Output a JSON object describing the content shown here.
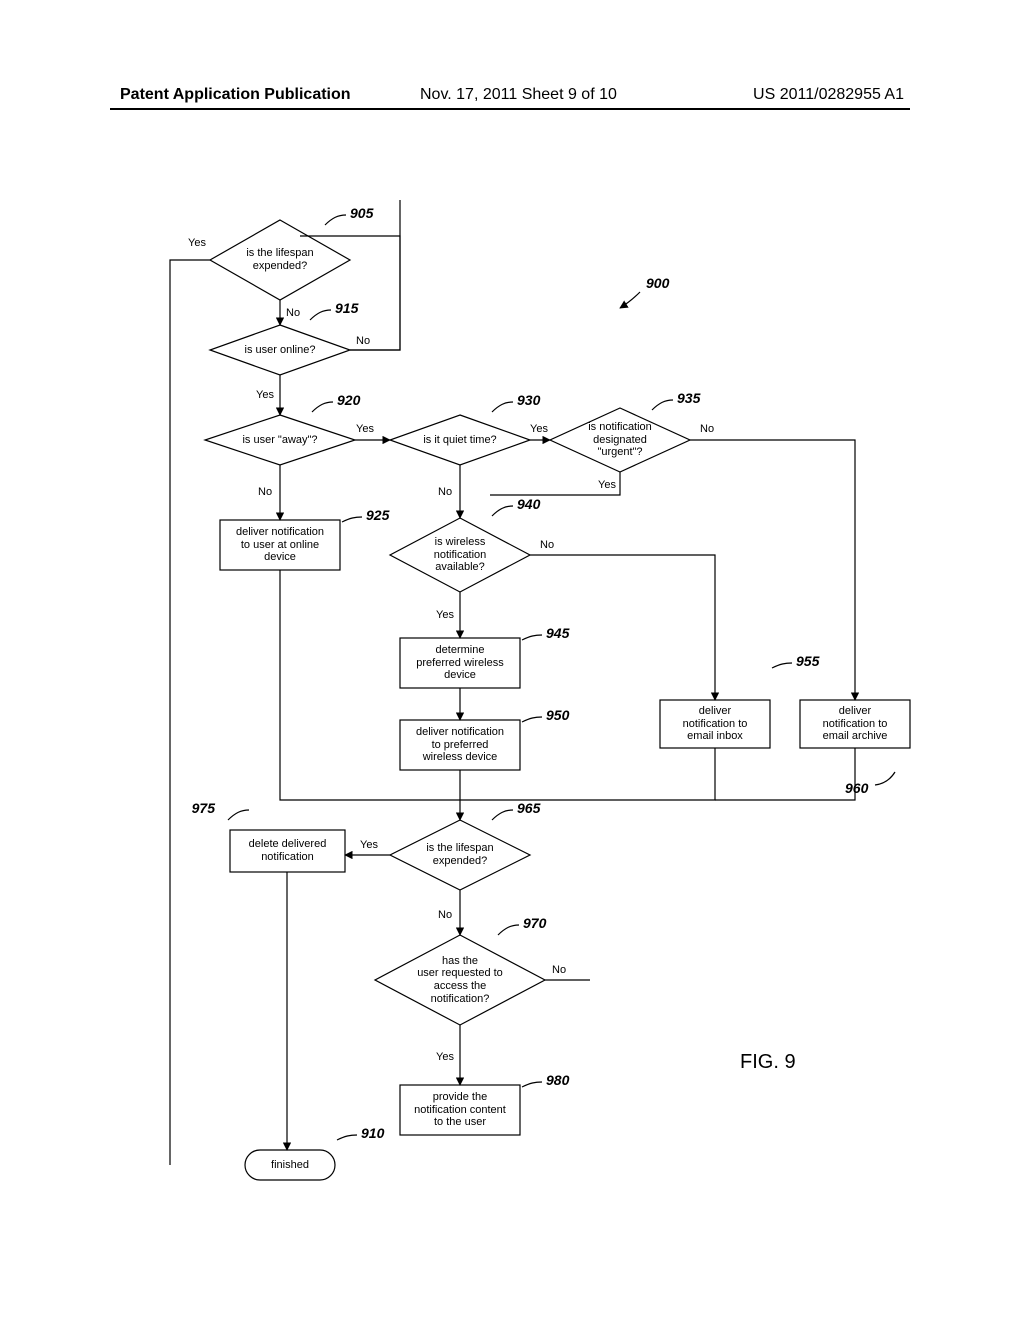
{
  "header": {
    "left": "Patent Application Publication",
    "center": "Nov. 17, 2011  Sheet 9 of 10",
    "right": "US 2011/0282955 A1"
  },
  "figure_label": "FIG. 9",
  "diagram_ref": "900",
  "nodes": {
    "n905": {
      "text": "is the lifespan\nexpended?",
      "ref": "905"
    },
    "n915": {
      "text": "is user online?",
      "ref": "915"
    },
    "n920": {
      "text": "is user \"away\"?",
      "ref": "920"
    },
    "n925": {
      "text": "deliver notification\nto user at online\ndevice",
      "ref": "925"
    },
    "n930": {
      "text": "is it quiet time?",
      "ref": "930"
    },
    "n935": {
      "text": "is notification\ndesignated\n\"urgent\"?",
      "ref": "935"
    },
    "n940": {
      "text": "is wireless\nnotification\navailable?",
      "ref": "940"
    },
    "n945": {
      "text": "determine\npreferred wireless\ndevice",
      "ref": "945"
    },
    "n950": {
      "text": "deliver notification\nto preferred\nwireless device",
      "ref": "950"
    },
    "n955": {
      "text": "deliver\nnotification to\nemail inbox",
      "ref": "955"
    },
    "n960": {
      "text": "deliver\nnotification to\nemail archive",
      "ref": "960"
    },
    "n965": {
      "text": "is the lifespan\nexpended?",
      "ref": "965"
    },
    "n970": {
      "text": "has the\nuser requested to\naccess the\nnotification?",
      "ref": "970"
    },
    "n975": {
      "text": "delete delivered\nnotification",
      "ref": "975"
    },
    "n980": {
      "text": "provide the\nnotification content\nto the user",
      "ref": "980"
    },
    "n910": {
      "text": "finished",
      "ref": "910"
    }
  },
  "edge_labels": {
    "yes": "Yes",
    "no": "No"
  }
}
